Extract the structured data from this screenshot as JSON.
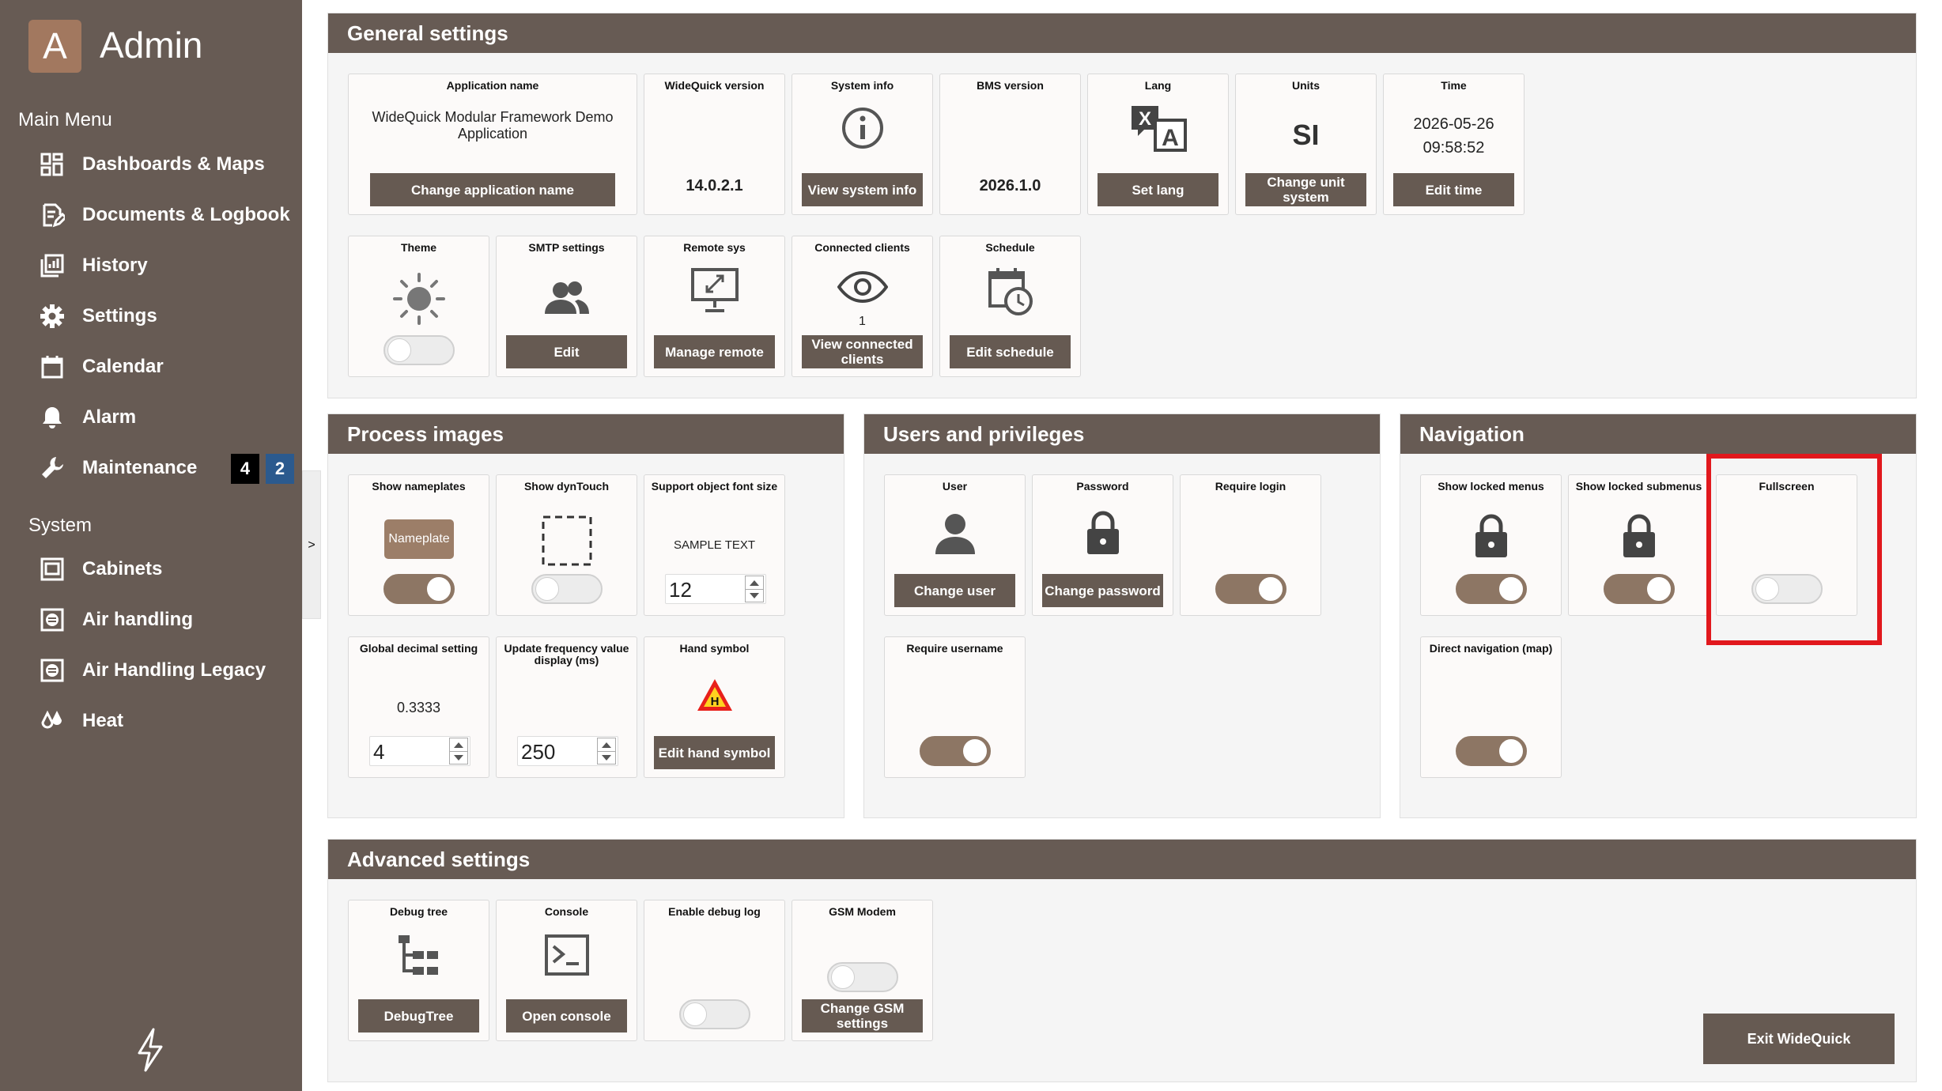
{
  "sidebar": {
    "logo_letter": "A",
    "title": "Admin",
    "main_menu_heading": "Main Menu",
    "main_menu": [
      {
        "label": "Dashboards & Maps",
        "icon": "dashboard-icon"
      },
      {
        "label": "Documents & Logbook",
        "icon": "document-edit-icon"
      },
      {
        "label": "History",
        "icon": "history-chart-icon"
      },
      {
        "label": "Settings",
        "icon": "gear-icon"
      },
      {
        "label": "Calendar",
        "icon": "calendar-icon"
      },
      {
        "label": "Alarm",
        "icon": "bell-icon"
      },
      {
        "label": "Maintenance",
        "icon": "wrench-icon"
      }
    ],
    "maintenance_badges": [
      {
        "value": "4",
        "color": "#000000"
      },
      {
        "value": "2",
        "color": "#2b5a8e"
      }
    ],
    "system_heading": "System",
    "system_menu": [
      {
        "label": "Cabinets",
        "icon": "cabinet-icon"
      },
      {
        "label": "Air handling",
        "icon": "air-handling-icon"
      },
      {
        "label": "Air Handling Legacy",
        "icon": "air-handling-icon"
      },
      {
        "label": "Heat",
        "icon": "heat-drops-icon"
      }
    ],
    "collapse_label": ">"
  },
  "general": {
    "title": "General settings",
    "app_name": {
      "title": "Application name",
      "value": "WideQuick Modular Framework Demo Application",
      "button": "Change application name"
    },
    "version": {
      "title": "WideQuick version",
      "value": "14.0.2.1"
    },
    "sysinfo": {
      "title": "System info",
      "button": "View system info"
    },
    "bms": {
      "title": "BMS version",
      "value": "2026.1.0"
    },
    "lang": {
      "title": "Lang",
      "button": "Set lang"
    },
    "units": {
      "title": "Units",
      "value": "SI",
      "button": "Change unit system"
    },
    "time": {
      "title": "Time",
      "date": "2026-05-26",
      "clock": "09:58:52",
      "button": "Edit time"
    },
    "theme": {
      "title": "Theme",
      "toggle_on": false
    },
    "smtp": {
      "title": "SMTP settings",
      "button": "Edit"
    },
    "remote": {
      "title": "Remote sys",
      "button": "Manage remote"
    },
    "clients": {
      "title": "Connected clients",
      "count": "1",
      "button": "View connected clients"
    },
    "schedule": {
      "title": "Schedule",
      "button": "Edit schedule"
    }
  },
  "process": {
    "title": "Process images",
    "nameplates": {
      "title": "Show nameplates",
      "chip": "Nameplate",
      "toggle_on": true
    },
    "dyntouch": {
      "title": "Show dynTouch",
      "toggle_on": false
    },
    "font": {
      "title": "Support object font size",
      "sample": "SAMPLE TEXT",
      "value": "12"
    },
    "decimal": {
      "title": "Global decimal setting",
      "preview": "0.3333",
      "value": "4"
    },
    "freq": {
      "title": "Update frequency value display (ms)",
      "value": "250"
    },
    "hand": {
      "title": "Hand symbol",
      "button": "Edit hand symbol",
      "symbol_letter": "H"
    }
  },
  "users": {
    "title": "Users and privileges",
    "user": {
      "title": "User",
      "button": "Change user"
    },
    "password": {
      "title": "Password",
      "button": "Change password"
    },
    "require_login": {
      "title": "Require login",
      "toggle_on": true
    },
    "require_username": {
      "title": "Require username",
      "toggle_on": true
    }
  },
  "navigation": {
    "title": "Navigation",
    "locked_menus": {
      "title": "Show locked menus",
      "toggle_on": true
    },
    "locked_submenus": {
      "title": "Show locked submenus",
      "toggle_on": true
    },
    "fullscreen": {
      "title": "Fullscreen",
      "toggle_on": false
    },
    "direct_nav": {
      "title": "Direct navigation (map)",
      "toggle_on": true
    }
  },
  "advanced": {
    "title": "Advanced settings",
    "debug_tree": {
      "title": "Debug tree",
      "button": "DebugTree"
    },
    "console": {
      "title": "Console",
      "button": "Open console"
    },
    "debug_log": {
      "title": "Enable debug log",
      "toggle_on": false
    },
    "gsm": {
      "title": "GSM Modem",
      "button": "Change GSM settings",
      "toggle_on": false
    }
  },
  "exit_button": "Exit WideQuick",
  "colors": {
    "sidebar": "#675b54",
    "button": "#665a52",
    "toggle_on": "#8d7664",
    "highlight": "#e1181d"
  }
}
